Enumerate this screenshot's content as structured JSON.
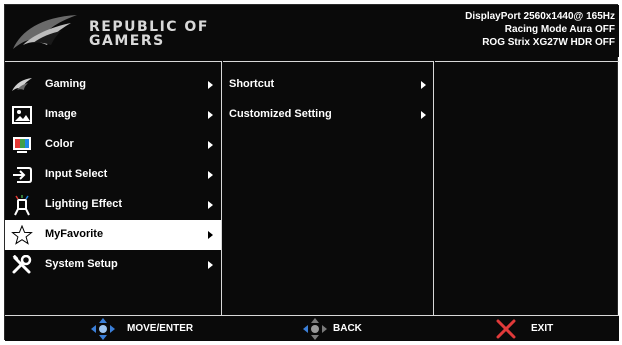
{
  "header": {
    "brand_line1": "REPUBLIC OF",
    "brand_line2": "GAMERS",
    "status_line1": "DisplayPort  2560x1440@  165Hz",
    "status_line2": "Racing Mode Aura OFF",
    "status_line3": "ROG Strix XG27W HDR OFF"
  },
  "main_menu": {
    "items": [
      {
        "label": "Gaming",
        "icon": "rog-eye-icon"
      },
      {
        "label": "Image",
        "icon": "image-icon"
      },
      {
        "label": "Color",
        "icon": "color-icon"
      },
      {
        "label": "Input Select",
        "icon": "input-select-icon"
      },
      {
        "label": "Lighting Effect",
        "icon": "lighting-effect-icon"
      },
      {
        "label": "MyFavorite",
        "icon": "star-icon",
        "selected": true
      },
      {
        "label": "System Setup",
        "icon": "tools-icon"
      }
    ]
  },
  "submenu": {
    "items": [
      {
        "label": "Shortcut"
      },
      {
        "label": "Customized Setting"
      }
    ]
  },
  "footer": {
    "move_label": "MOVE/ENTER",
    "back_label": "BACK",
    "exit_label": "EXIT"
  },
  "colors": {
    "background": "#0a0a0a",
    "accent_blue": "#3b7fd8",
    "exit_red": "#e03a3a",
    "selected_bg": "#ffffff"
  }
}
